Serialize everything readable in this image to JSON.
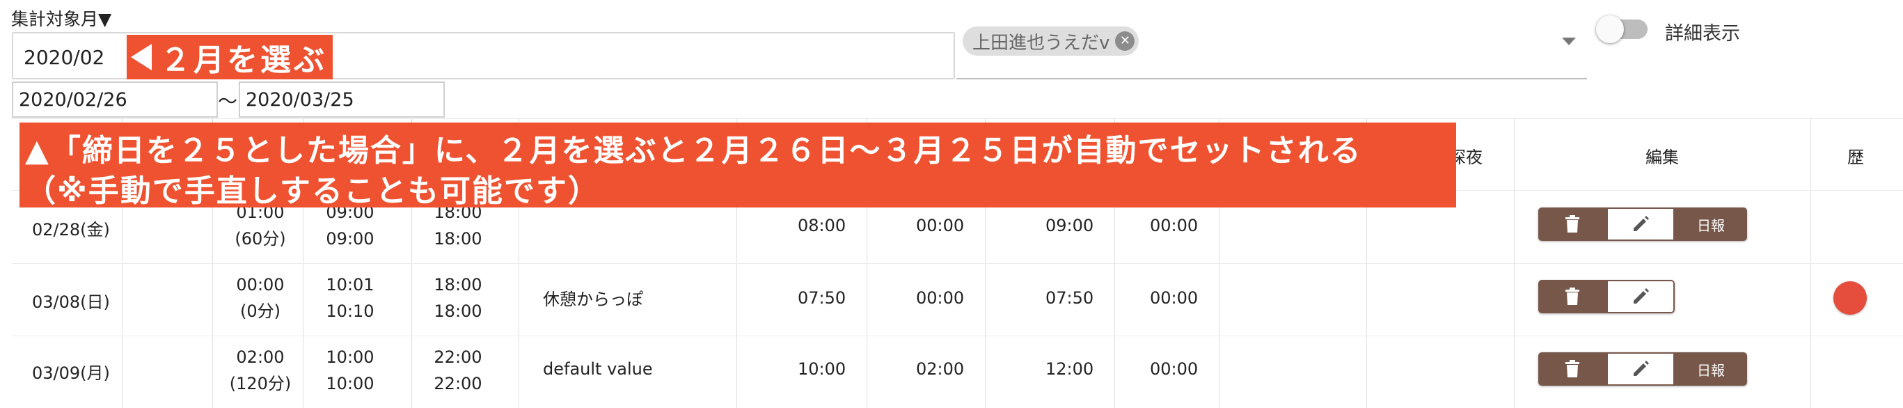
{
  "filters": {
    "month_label": "集計対象月▼",
    "month_value": "2020/02",
    "user_chip": "上田進也うえだv",
    "detail_toggle_label": "詳細表示",
    "date_start": "2020/02/26",
    "date_separator": "〜",
    "date_end": "2020/03/25"
  },
  "annotations": {
    "month_callout": "２月を選ぶ",
    "banner_line1": "▲「締日を２５とした場合」に、２月を選ぶと２月２６日〜３月２５日が自動でセットされる",
    "banner_line2": "（※手動で手直しすることも可能です）"
  },
  "table": {
    "headers": {
      "late_night": "深夜",
      "edit": "編集",
      "history": "歴"
    },
    "rows": [
      {
        "date": "02/28(金)",
        "break_time": "01:00",
        "break_minutes": "(60分)",
        "start_1": "09:00",
        "start_2": "09:00",
        "end_1": "18:00",
        "end_2": "18:00",
        "memo": "",
        "work": "08:00",
        "overtime": "00:00",
        "total": "09:00",
        "night": "00:00",
        "report_label": "日報"
      },
      {
        "date": "03/08(日)",
        "break_time": "00:00",
        "break_minutes": "(0分)",
        "start_1": "10:01",
        "start_2": "10:10",
        "end_1": "18:00",
        "end_2": "18:00",
        "memo": "休憩からっぽ",
        "work": "07:50",
        "overtime": "00:00",
        "total": "07:50",
        "night": "00:00"
      },
      {
        "date": "03/09(月)",
        "break_time": "02:00",
        "break_minutes": "(120分)",
        "start_1": "10:00",
        "start_2": "10:00",
        "end_1": "22:00",
        "end_2": "22:00",
        "memo": "default value",
        "work": "10:00",
        "overtime": "02:00",
        "total": "12:00",
        "night": "00:00",
        "report_label": "日報"
      }
    ]
  },
  "colors": {
    "annotation_orange": "#ef5230",
    "button_brown": "#77574a",
    "history_red": "#e54d3d"
  }
}
